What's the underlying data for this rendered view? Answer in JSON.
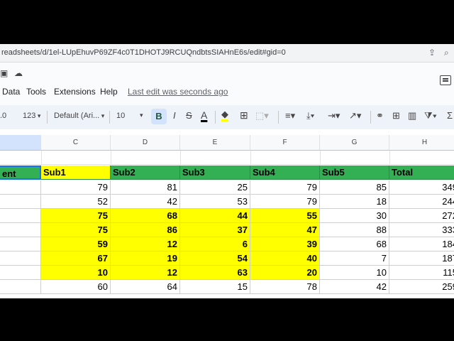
{
  "address_bar": {
    "url": "readsheets/d/1el-LUpEhuvP69ZF4c0T1DHOTJ9RCUQndbtsSIAHnE6s/edit#gid=0"
  },
  "menu": {
    "items": [
      "Data",
      "Tools",
      "Extensions",
      "Help"
    ],
    "last_edit": "Last edit was seconds ago"
  },
  "toolbar": {
    "decimal": ".0",
    "number_format": "123",
    "font": "Default (Ari...",
    "font_size": "10",
    "bold": "B",
    "italic": "I",
    "strike": "S",
    "text_color": "A"
  },
  "colors": {
    "header_green": "#34b054",
    "highlight_yellow": "#ffff00"
  },
  "grid": {
    "column_letters": [
      "",
      "C",
      "D",
      "E",
      "F",
      "G",
      "H"
    ],
    "header_row": [
      "ent",
      "Sub1",
      "Sub2",
      "Sub3",
      "Sub4",
      "Sub5",
      "Total"
    ],
    "rows": [
      {
        "values": [
          "",
          "79",
          "81",
          "25",
          "79",
          "85",
          "349"
        ],
        "highlight": false
      },
      {
        "values": [
          "",
          "52",
          "42",
          "53",
          "79",
          "18",
          "244"
        ],
        "highlight": false
      },
      {
        "values": [
          "",
          "75",
          "68",
          "44",
          "55",
          "30",
          "272"
        ],
        "highlight": true
      },
      {
        "values": [
          "",
          "75",
          "86",
          "37",
          "47",
          "88",
          "333"
        ],
        "highlight": true
      },
      {
        "values": [
          "",
          "59",
          "12",
          "6",
          "39",
          "68",
          "184"
        ],
        "highlight": true
      },
      {
        "values": [
          "",
          "67",
          "19",
          "54",
          "40",
          "7",
          "187"
        ],
        "highlight": true
      },
      {
        "values": [
          "",
          "10",
          "12",
          "63",
          "20",
          "10",
          "115"
        ],
        "highlight": true
      },
      {
        "values": [
          "",
          "60",
          "64",
          "15",
          "78",
          "42",
          "259"
        ],
        "highlight": false
      }
    ]
  }
}
